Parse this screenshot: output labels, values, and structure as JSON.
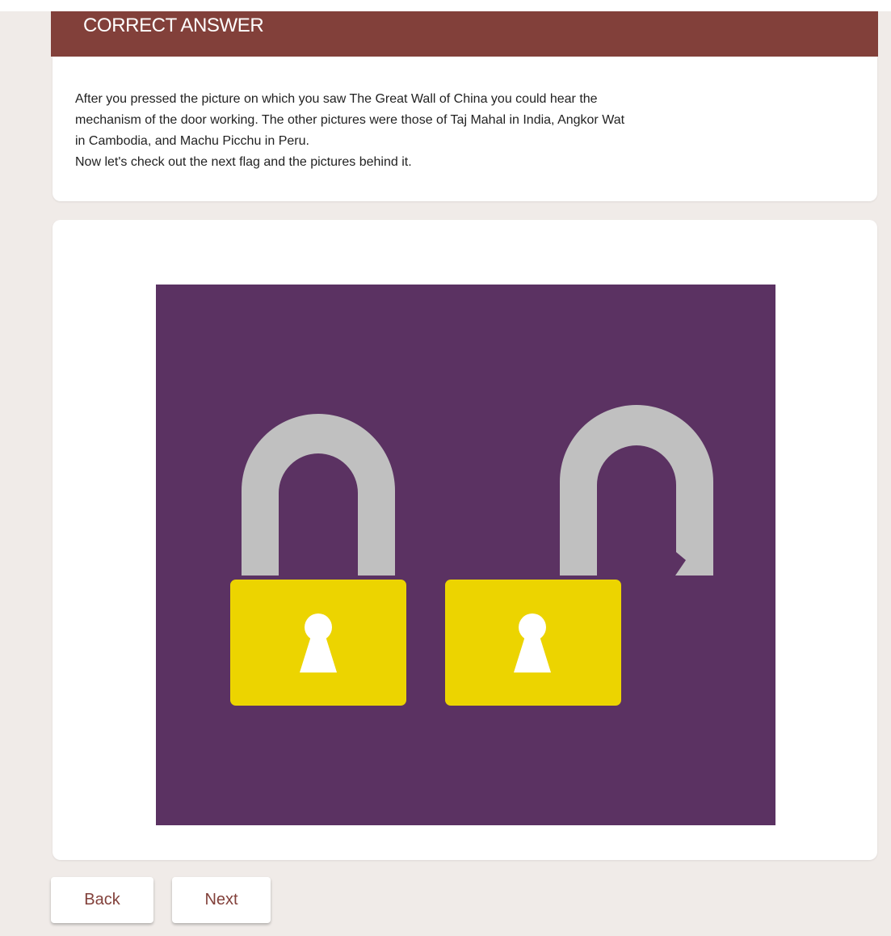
{
  "header": {
    "title": "CORRECT ANSWER"
  },
  "feedback": {
    "lines": [
      "After you pressed the picture on which you saw The Great Wall of China you could hear the",
      "mechanism of the door working. The other pictures were those of Taj Mahal in India, Angkor Wat",
      "in Cambodia, and Machu Picchu in Peru.",
      "Now let's check out the next flag and the pictures behind it."
    ]
  },
  "illustration": {
    "icons": [
      "closed-padlock-icon",
      "open-padlock-icon"
    ],
    "colors": {
      "background": "#5b3262",
      "lock_body": "#ecd400",
      "shackle": "#c0c0c0",
      "keyhole": "#ffffff"
    }
  },
  "navigation": {
    "back_label": "Back",
    "next_label": "Next"
  },
  "colors": {
    "accent": "#82403a",
    "page_background": "#f0ebe8"
  }
}
